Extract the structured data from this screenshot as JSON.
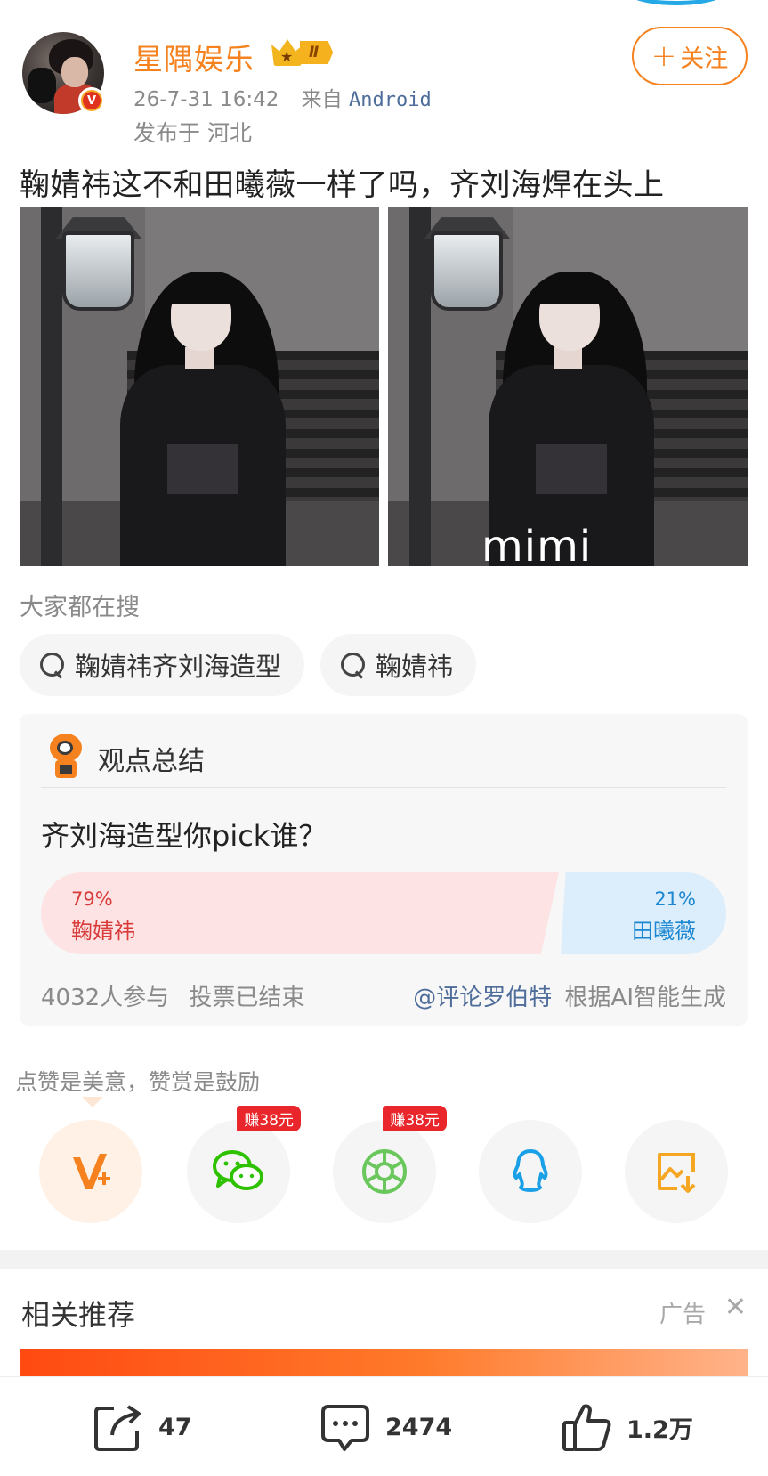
{
  "colors": {
    "brand_orange": "#f5821f",
    "poll_red": "#d93a3a",
    "poll_blue": "#1b86d1",
    "link_blue": "#4e6d9a",
    "earn_red": "#e8262b"
  },
  "post": {
    "user": {
      "name": "星隅娱乐",
      "level": "Ⅱ",
      "verified": true
    },
    "meta": {
      "time": "26-7-31 16:42",
      "from_prefix": "来自",
      "from_app": "Android",
      "location": "发布于 河北"
    },
    "follow_label": "关注",
    "text": "鞠婧祎这不和田曦薇一样了吗，齐刘海焊在头上",
    "images": [
      {
        "watermark": ""
      },
      {
        "watermark": "mimi"
      }
    ]
  },
  "search": {
    "title": "大家都在搜",
    "chips": [
      {
        "label": "鞠婧祎齐刘海造型"
      },
      {
        "label": "鞠婧祎"
      }
    ]
  },
  "summary": {
    "title": "观点总结",
    "question": "齐刘海造型你pick谁？",
    "options": [
      {
        "name": "鞠婧祎",
        "percent_label": "79%",
        "share": 0.79
      },
      {
        "name": "田曦薇",
        "percent_label": "21%",
        "share": 0.21
      }
    ],
    "participants": "4032人参与",
    "status": "投票已结束",
    "author": "@评论罗伯特",
    "generated_by": "根据AI智能生成"
  },
  "reward": {
    "text": "点赞是美意，赞赏是鼓励"
  },
  "share": {
    "buttons": [
      {
        "icon": "v-plus-icon",
        "badge": ""
      },
      {
        "icon": "wechat-icon",
        "badge": "赚38元"
      },
      {
        "icon": "moments-icon",
        "badge": "赚38元"
      },
      {
        "icon": "qq-icon",
        "badge": ""
      },
      {
        "icon": "save-image-icon",
        "badge": ""
      }
    ]
  },
  "related": {
    "title": "相关推荐",
    "ad_label": "广告"
  },
  "actions": {
    "repost_count": "47",
    "comment_count": "2474",
    "like_count": "1.2万"
  }
}
